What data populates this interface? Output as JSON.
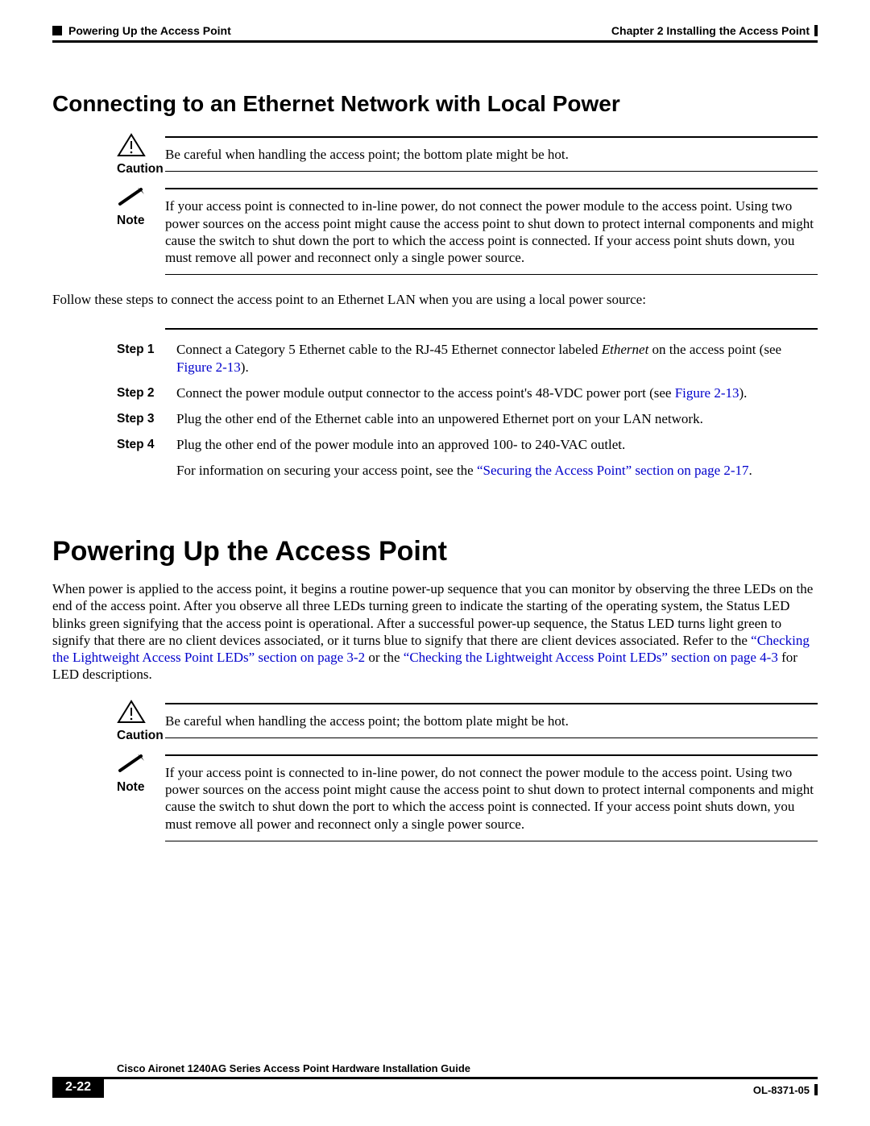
{
  "header": {
    "section": "Powering Up the Access Point",
    "chapter": "Chapter 2      Installing the Access Point"
  },
  "section1": {
    "title": "Connecting to an Ethernet Network with Local Power",
    "caution": {
      "label": "Caution",
      "text": "Be careful when handling the access point; the bottom plate might be hot."
    },
    "note": {
      "label": "Note",
      "text": "If your access point is connected to in-line power, do not connect the power module to the access point. Using two power sources on the access point might cause the access point to shut down to protect internal components and might cause the switch to shut down the port to which the access point is connected. If your access point shuts down, you must remove all power and reconnect only a single power source."
    },
    "intro": "Follow these steps to connect the access point to an Ethernet LAN when you are using a local power source:",
    "steps": [
      {
        "label": "Step 1",
        "pre": "Connect a Category 5 Ethernet cable to the RJ-45 Ethernet connector labeled ",
        "em": "Ethernet",
        "post": " on the access point (see ",
        "link": "Figure 2-13",
        "tail": ")."
      },
      {
        "label": "Step 2",
        "pre": "Connect the power module output connector to the access point's 48-VDC power port (see ",
        "link": "Figure 2-13",
        "tail": ")."
      },
      {
        "label": "Step 3",
        "text": "Plug the other end of the Ethernet cable into an unpowered Ethernet port on your LAN network."
      },
      {
        "label": "Step 4",
        "text": "Plug the other end of the power module into an approved 100- to 240-VAC outlet."
      }
    ],
    "afterSteps": {
      "pre": "For information on securing your access point, see the ",
      "link": "“Securing the Access Point” section on page 2-17",
      "tail": "."
    }
  },
  "section2": {
    "title": "Powering Up the Access Point",
    "para": {
      "pre": "When power is applied to the access point, it begins a routine power-up sequence that you can monitor by observing the three LEDs on the end of the access point. After you observe all three LEDs turning green to indicate the starting of the operating system, the Status LED blinks green signifying that the access point is operational. After a successful power-up sequence, the Status LED turns light green to signify that there are no client devices associated, or it turns blue to signify that there are client devices associated. Refer to the ",
      "link1": "“Checking the Lightweight Access Point LEDs” section on page 3-2",
      "mid": " or the ",
      "link2": "“Checking the Lightweight Access Point LEDs” section on page 4-3",
      "tail": " for LED descriptions."
    },
    "caution": {
      "label": "Caution",
      "text": "Be careful when handling the access point; the bottom plate might be hot."
    },
    "note": {
      "label": "Note",
      "text": "If your access point is connected to in-line power, do not connect the power module to the access point. Using two power sources on the access point might cause the access point to shut down to protect internal components and might cause the switch to shut down the port to which the access point is connected. If your access point shuts down, you must remove all power and reconnect only a single power source."
    }
  },
  "footer": {
    "guide": "Cisco Aironet 1240AG Series Access Point Hardware Installation Guide",
    "page": "2-22",
    "docnum": "OL-8371-05"
  }
}
